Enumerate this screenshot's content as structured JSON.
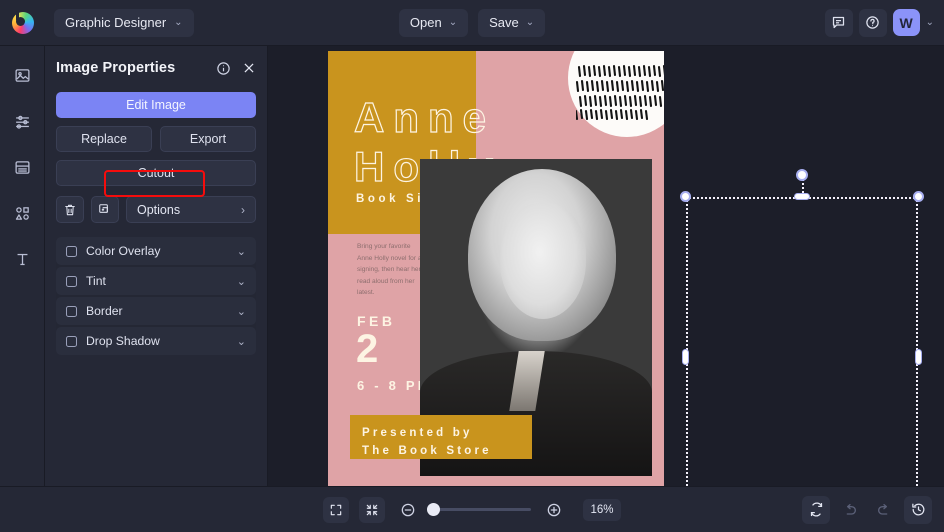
{
  "topbar": {
    "logo_icon": "app-logo-icon",
    "document_name": "Graphic Designer",
    "document_caret": "⌄",
    "open_label": "Open",
    "open_caret": "⌄",
    "save_label": "Save",
    "save_caret": "⌄",
    "comment_icon": "comment-icon",
    "help_icon": "help-circle-icon",
    "avatar_initial": "W",
    "account_caret": "⌄"
  },
  "rail": {
    "items": [
      {
        "icon": "image-icon",
        "name": "sidebar-item-image"
      },
      {
        "icon": "adjustments-icon",
        "name": "sidebar-item-adjustments"
      },
      {
        "icon": "layers-icon",
        "name": "sidebar-item-layers"
      },
      {
        "icon": "shapes-icon",
        "name": "sidebar-item-shapes"
      },
      {
        "icon": "text-icon",
        "name": "sidebar-item-text"
      }
    ]
  },
  "panel": {
    "title": "Image Properties",
    "info_icon": "info-icon",
    "close_icon": "close-icon",
    "edit_image_label": "Edit Image",
    "replace_label": "Replace",
    "export_label": "Export",
    "cutout_label": "Cutout",
    "delete_icon": "trash-icon",
    "duplicate_icon": "duplicate-icon",
    "options_label": "Options",
    "options_chevron": "›",
    "highlight_color": "#f50c0c",
    "effects": [
      {
        "label": "Color Overlay",
        "checked": false,
        "chevron": "⌄"
      },
      {
        "label": "Tint",
        "checked": false,
        "chevron": "⌄"
      },
      {
        "label": "Border",
        "checked": false,
        "chevron": "⌄"
      },
      {
        "label": "Drop Shadow",
        "checked": false,
        "chevron": "⌄"
      }
    ]
  },
  "poster": {
    "title_line1": "Anne",
    "title_line2": "Holly",
    "subtitle": "Book Signing",
    "body": "Bring your favorite Anne Holly novel for a signing, then hear her read aloud from her latest.",
    "month": "FEB",
    "day": "2",
    "time": "6 - 8 PM",
    "presented_line1": "Presented by",
    "presented_line2": "The Book Store",
    "colors": {
      "background_pink": "#dfa3a6",
      "gold": "#c9941e",
      "olive": "#6e6517",
      "cream": "#fdf4e3",
      "blob_white": "#fdfbf9"
    }
  },
  "canvas": {
    "selection_label": "image-selection-box"
  },
  "bottombar": {
    "fit_screen_icon": "fit-screen-icon",
    "fit_selection_icon": "fit-selection-icon",
    "zoom_out_icon": "zoom-out-icon",
    "zoom_in_icon": "zoom-in-icon",
    "zoom_level": "16%",
    "sync_icon": "sync-icon",
    "undo_icon": "undo-icon",
    "redo_icon": "redo-icon",
    "history_icon": "history-icon"
  }
}
